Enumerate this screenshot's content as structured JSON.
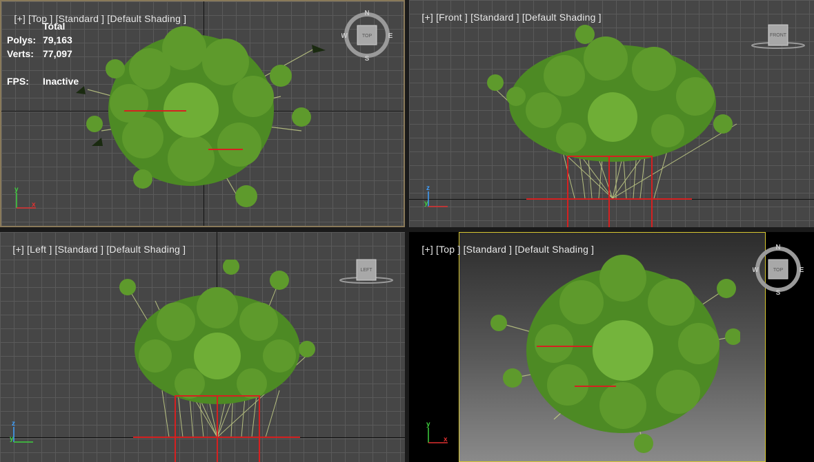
{
  "viewports": {
    "top": {
      "label_plus": "[+]",
      "label_view": "[Top ]",
      "label_standard": "[Standard ]",
      "label_shading": "[Default Shading ]",
      "stats": {
        "header": "Total",
        "polys_label": "Polys:",
        "polys_value": "79,163",
        "verts_label": "Verts:",
        "verts_value": "77,097",
        "fps_label": "FPS:",
        "fps_value": "Inactive"
      },
      "cube_label": "TOP",
      "compass": {
        "n": "N",
        "s": "S",
        "e": "E",
        "w": "W"
      }
    },
    "front": {
      "label_plus": "[+]",
      "label_view": "[Front ]",
      "label_standard": "[Standard ]",
      "label_shading": "[Default Shading ]",
      "cube_label": "FRONT"
    },
    "left": {
      "label_plus": "[+]",
      "label_view": "[Left ]",
      "label_standard": "[Standard ]",
      "label_shading": "[Default Shading ]",
      "cube_label": "LEFT"
    },
    "persp": {
      "label_plus": "[+]",
      "label_view": "[Top ]",
      "label_standard": "[Standard ]",
      "label_shading": "[Default Shading ]",
      "cube_label": "TOP",
      "compass": {
        "n": "N",
        "s": "S",
        "e": "E",
        "w": "W"
      }
    }
  },
  "axes": {
    "x": "x",
    "y": "y",
    "z": "z"
  },
  "colors": {
    "grid_bg": "#464646",
    "grid_line": "#5a5a5a",
    "active_border": "#d8c830",
    "leaf": "#5e9a2c",
    "stem": "#c9d48a",
    "origin": "#d62020"
  },
  "icons": [
    "viewcube-icon",
    "compass-ring-icon",
    "axis-tripod-icon"
  ]
}
